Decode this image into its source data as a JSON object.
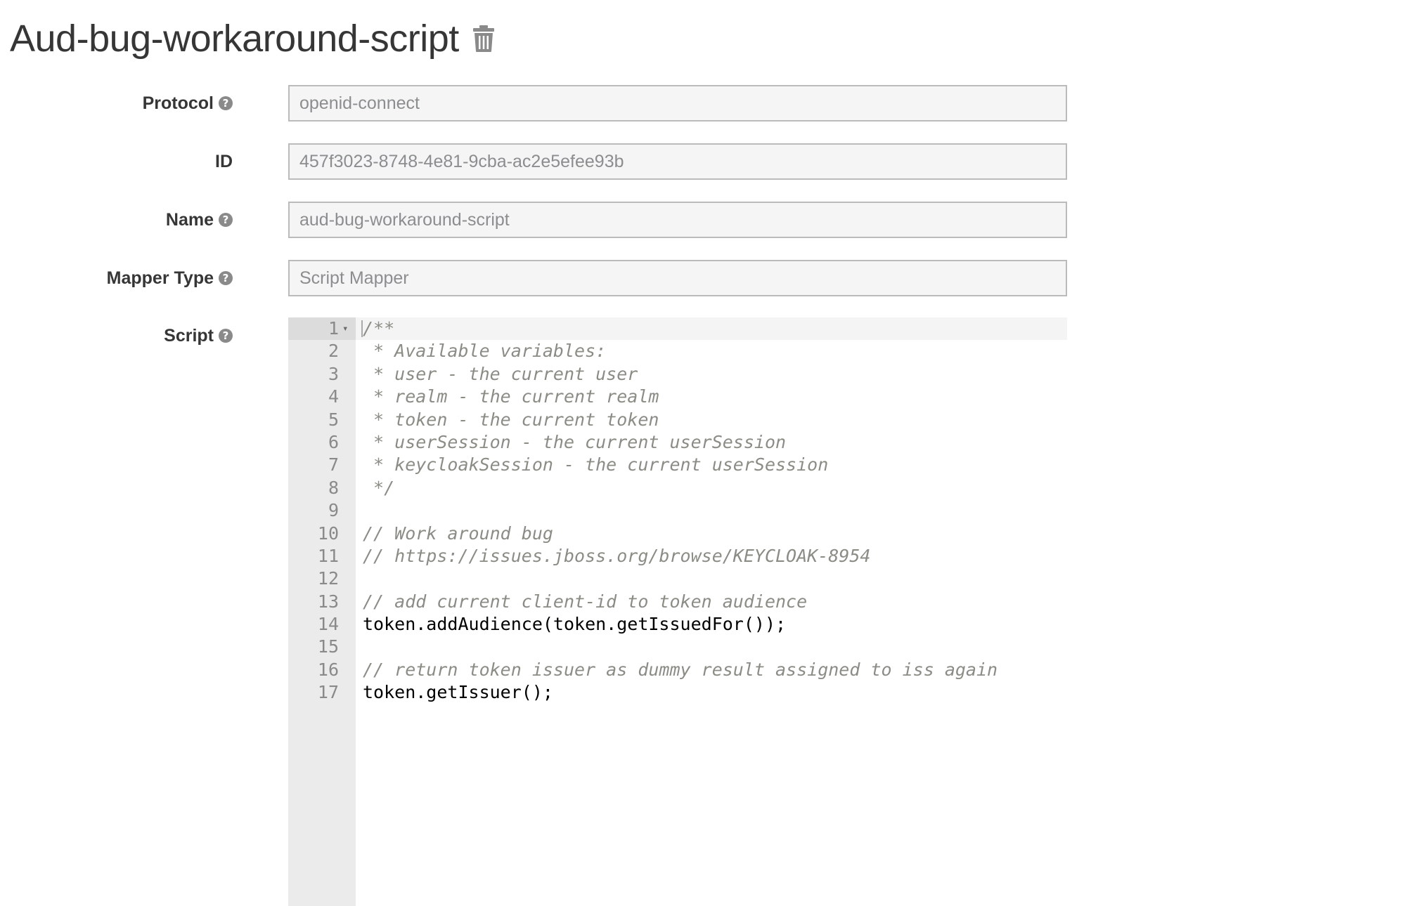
{
  "page": {
    "title": "Aud-bug-workaround-script"
  },
  "form": {
    "protocol": {
      "label": "Protocol",
      "value": "openid-connect"
    },
    "id": {
      "label": "ID",
      "value": "457f3023-8748-4e81-9cba-ac2e5efee93b"
    },
    "name": {
      "label": "Name",
      "value": "aud-bug-workaround-script"
    },
    "mapper_type": {
      "label": "Mapper Type",
      "value": "Script Mapper"
    },
    "script": {
      "label": "Script"
    }
  },
  "script_editor": {
    "lines": [
      {
        "num": "1",
        "text": "/**",
        "kind": "comment"
      },
      {
        "num": "2",
        "text": " * Available variables:",
        "kind": "comment"
      },
      {
        "num": "3",
        "text": " * user - the current user",
        "kind": "comment"
      },
      {
        "num": "4",
        "text": " * realm - the current realm",
        "kind": "comment"
      },
      {
        "num": "5",
        "text": " * token - the current token",
        "kind": "comment"
      },
      {
        "num": "6",
        "text": " * userSession - the current userSession",
        "kind": "comment"
      },
      {
        "num": "7",
        "text": " * keycloakSession - the current userSession",
        "kind": "comment"
      },
      {
        "num": "8",
        "text": " */",
        "kind": "comment"
      },
      {
        "num": "9",
        "text": "",
        "kind": "code"
      },
      {
        "num": "10",
        "text": "// Work around bug",
        "kind": "comment"
      },
      {
        "num": "11",
        "text": "// https://issues.jboss.org/browse/KEYCLOAK-8954",
        "kind": "comment"
      },
      {
        "num": "12",
        "text": "",
        "kind": "code"
      },
      {
        "num": "13",
        "text": "// add current client-id to token audience",
        "kind": "comment"
      },
      {
        "num": "14",
        "text": "token.addAudience(token.getIssuedFor());",
        "kind": "code"
      },
      {
        "num": "15",
        "text": "",
        "kind": "code"
      },
      {
        "num": "16",
        "text": "// return token issuer as dummy result assigned to iss again",
        "kind": "comment"
      },
      {
        "num": "17",
        "text": "token.getIssuer();",
        "kind": "code"
      }
    ]
  },
  "icons": {
    "delete": "trash-icon",
    "help": "question-circle-icon",
    "fold": "fold-arrow-icon"
  },
  "colors": {
    "comment": "#8c8c86",
    "gutter": "#ebebeb",
    "input_bg": "#f5f5f5"
  }
}
